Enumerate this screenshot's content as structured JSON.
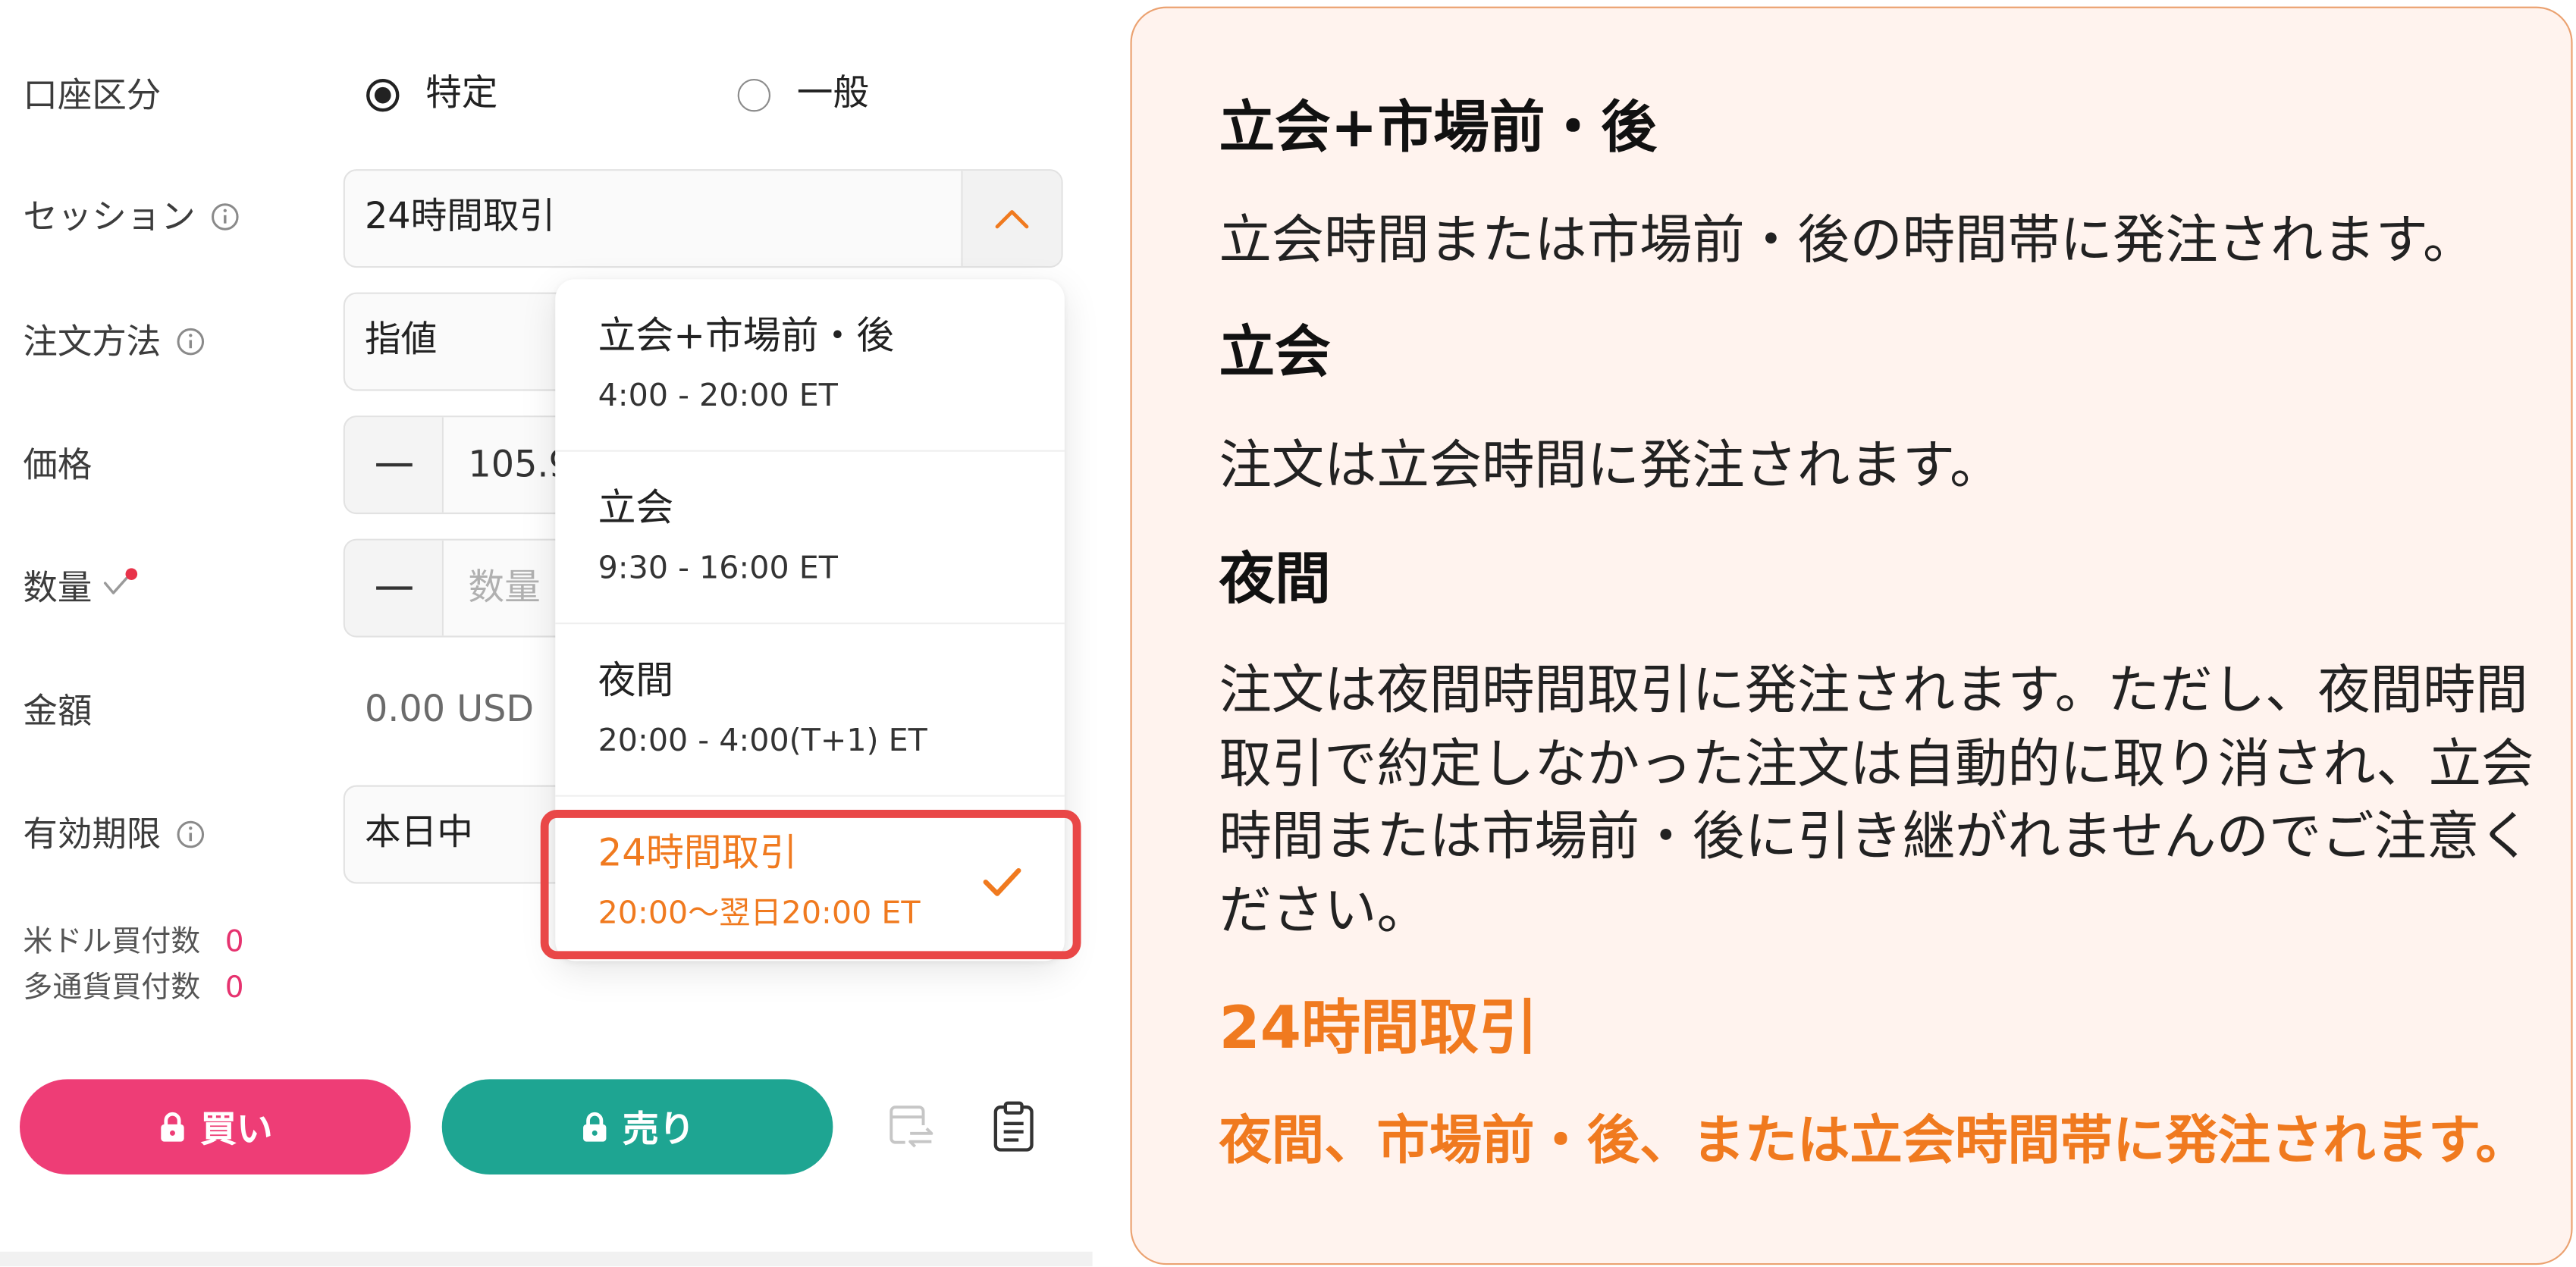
{
  "order_form": {
    "account_type": {
      "label": "口座区分",
      "options": [
        {
          "label": "特定",
          "selected": true
        },
        {
          "label": "一般",
          "selected": false
        }
      ]
    },
    "session": {
      "label": "セッション",
      "value": "24時間取引",
      "expanded": true
    },
    "order_method": {
      "label": "注文方法",
      "value": "指値"
    },
    "price": {
      "label": "価格",
      "value": "105.9"
    },
    "quantity": {
      "label": "数量",
      "placeholder": "数量"
    },
    "amount": {
      "label": "金額",
      "value": "0.00 USD"
    },
    "expiry": {
      "label": "有効期限",
      "value": "本日中"
    },
    "usd_buy_count": {
      "label": "米ドル買付数",
      "value": "0"
    },
    "multi_currency_buy_count": {
      "label": "多通貨買付数",
      "value": "0"
    },
    "buy_button": {
      "label": "買い"
    },
    "sell_button": {
      "label": "売り"
    }
  },
  "session_dropdown": {
    "options": [
      {
        "title": "立会+市場前・後",
        "hours": "4:00 - 20:00 ET",
        "selected": false
      },
      {
        "title": "立会",
        "hours": "9:30 - 16:00 ET",
        "selected": false
      },
      {
        "title": "夜間",
        "hours": "20:00 - 4:00(T+1) ET",
        "selected": false
      },
      {
        "title": "24時間取引",
        "hours": "20:00〜翌日20:00 ET",
        "selected": true
      }
    ]
  },
  "help_panel": {
    "sections": [
      {
        "heading": "立会+市場前・後",
        "body": "立会時間または市場前・後の時間帯に発注されます。",
        "highlighted": false
      },
      {
        "heading": "立会",
        "body": "注文は立会時間に発注されます。",
        "highlighted": false
      },
      {
        "heading": "夜間",
        "body": "注文は夜間時間取引に発注されます。ただし、夜間時間取引で約定しなかった注文は自動的に取り消され、立会時間または市場前・後に引き継がれませんのでご注意ください。",
        "highlighted": false
      },
      {
        "heading": "24時間取引",
        "body": "夜間、市場前・後、または立会時間帯に発注されます。",
        "highlighted": true
      }
    ]
  },
  "icons": {
    "info": "info-icon",
    "session_toggle": "chevron-up-icon",
    "decrement": "minus-icon",
    "quantity_badge": "check-badge-icon",
    "selected_option": "check-icon",
    "button_lock": "lock-icon",
    "transfer": "transfer-icon",
    "clipboard": "clipboard-icon"
  },
  "colors": {
    "accent": "#F07A1F",
    "buy": "#EE3D76",
    "sell": "#1EA592",
    "highlight": "#E94747",
    "help_bg": "#FFF3EE",
    "help_border": "#EBA271",
    "count": "#E6336F"
  }
}
